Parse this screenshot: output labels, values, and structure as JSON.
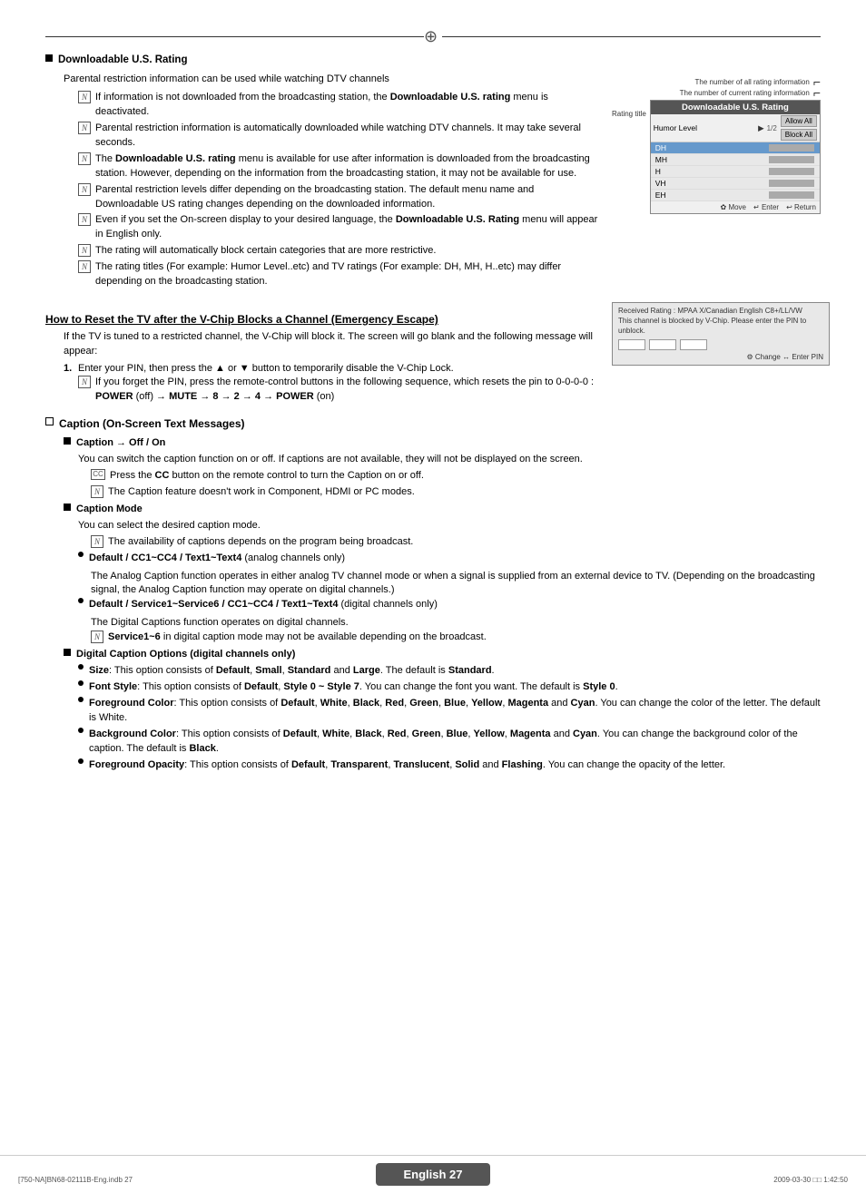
{
  "page": {
    "title": "English - 27",
    "page_number": "English 27",
    "footer_left": "[750-NA]BN68-02111B-Eng.indb   27",
    "footer_right": "2009-03-30   □□ 1:42:50"
  },
  "top_decoration": {
    "compass": "⊕"
  },
  "downloadable_section": {
    "heading": "Downloadable U.S. Rating",
    "intro": "Parental restriction information can be used while watching DTV channels",
    "notes": [
      "If information is not downloaded from the broadcasting station, the Downloadable U.S. rating menu is deactivated.",
      "Parental restriction information is automatically downloaded while watching DTV channels. It may take several seconds.",
      "The Downloadable U.S. rating menu is available for use after information is downloaded from the broadcasting station. However, depending on the information from the broadcasting station, it may not be available for use.",
      "Parental restriction levels differ depending on the broadcasting station. The default menu name and Downloadable US rating changes depending on the downloaded information.",
      "Even if you set the On-screen display to your desired language, the Downloadable U.S. Rating menu will appear in English only.",
      "The rating will automatically block certain categories that are more restrictive.",
      "The rating titles (For example: Humor Level..etc) and TV ratings (For example: DH, MH, H..etc) may differ depending on the broadcasting station."
    ]
  },
  "rating_ui": {
    "top_label1": "The number of all rating information",
    "top_label2": "The number of current rating information",
    "left_label1": "Rating title",
    "header": "Downloadable U.S. Rating",
    "humor_row": "Humor Level",
    "humor_arrow": "▶",
    "humor_value": "1/2",
    "items": [
      "DH",
      "MH",
      "H",
      "VH",
      "EH"
    ],
    "selected_item": "DH",
    "btn_allow": "Allow All",
    "btn_block": "Block All",
    "footer_move": "✿ Move",
    "footer_enter": "↵ Enter",
    "footer_return": "↩ Return"
  },
  "emergency_section": {
    "heading": "How to Reset the TV after the V-Chip Blocks a Channel (Emergency Escape)",
    "intro": "If the TV is tuned to a restricted channel, the V-Chip will block it. The screen will go blank and the following message will appear:",
    "steps": [
      "Enter your PIN, then press the ▲ or ▼ button to temporarily disable the V-Chip Lock."
    ],
    "note": "If you forget the PIN, press the remote-control buttons in the following sequence, which resets the pin to 0-0-0-0 :",
    "sequence": "POWER (off) → MUTE → 8 → 2 → 4 → POWER (on)"
  },
  "vchip_ui": {
    "title_row": "Received Rating : MPAA X/Canadian English   C8+/LL/VW",
    "body": "This channel is blocked by V-Chip. Please enter the PIN to unblock.",
    "footer": "⚙ Change   ↔ Enter PIN"
  },
  "caption_section": {
    "heading": "Caption (On-Screen Text Messages)",
    "caption_off_on": {
      "title": "Caption → Off / On",
      "desc": "You can switch the caption function on or off. If captions are not available, they will not be displayed on the screen.",
      "note1": "Press the CC button on the remote control to turn the Caption on or off.",
      "note2": "The Caption feature doesn't work in Component, HDMI or PC modes."
    },
    "caption_mode": {
      "title": "Caption Mode",
      "desc": "You can select the desired caption mode.",
      "note": "The availability of captions depends on the program being broadcast.",
      "items": [
        {
          "label": "Default / CC1~CC4 / Text1~Text4",
          "qualifier": "(analog channels only)",
          "desc": "The Analog Caption function operates in either analog TV channel mode or when a signal is supplied from an external device to TV. (Depending on the broadcasting signal, the Analog Caption function may operate on digital channels.)"
        },
        {
          "label": "Default / Service1~Service6 / CC1~CC4 / Text1~Text4",
          "qualifier": "(digital channels only)",
          "desc": "The Digital Captions function operates on digital channels.",
          "sub_note": "Service1~6 in digital caption mode may not be available depending on the broadcast."
        }
      ]
    },
    "digital_caption": {
      "title": "Digital Caption Options (digital channels only)",
      "items": [
        {
          "label": "Size",
          "desc": "This option consists of Default, Small, Standard and Large. The default is Standard."
        },
        {
          "label": "Font Style",
          "desc": "This option consists of Default, Style 0 ~ Style 7. You can change the font you want. The default is Style 0."
        },
        {
          "label": "Foreground Color",
          "desc": "This option consists of Default, White, Black, Red, Green, Blue, Yellow, Magenta and Cyan. You can change the color of the letter. The default is White."
        },
        {
          "label": "Background Color",
          "desc": "This option consists of Default, White, Black, Red, Green, Blue, Yellow, Magenta and Cyan. You can change the background color of the caption. The default is Black."
        },
        {
          "label": "Foreground Opacity",
          "desc": "This option consists of Default, Transparent, Translucent, Solid and Flashing. You can change the opacity of the letter."
        }
      ]
    }
  }
}
